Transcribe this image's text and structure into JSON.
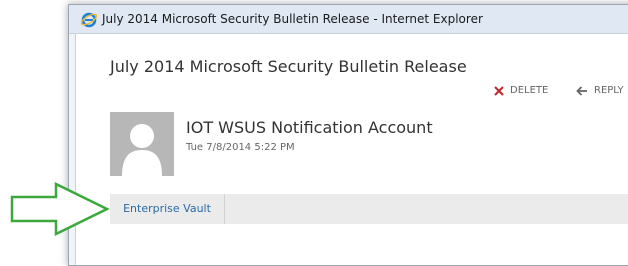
{
  "window": {
    "title": "July 2014 Microsoft Security Bulletin Release - Internet Explorer"
  },
  "message": {
    "subject": "July 2014 Microsoft Security Bulletin Release",
    "sender": "IOT WSUS Notification Account",
    "date": "Tue 7/8/2014 5:22 PM",
    "actions": {
      "delete": "DELETE",
      "reply": "REPLY"
    }
  },
  "tabs": [
    {
      "label": "Enterprise Vault"
    }
  ],
  "colors": {
    "delete_icon": "#c0292b",
    "tab_text": "#2a6aa6",
    "annotation_arrow": "#3aa83a"
  },
  "icons": {
    "browser": "internet-explorer-icon",
    "delete": "x-icon",
    "reply": "reply-arrow-icon",
    "avatar": "person-silhouette-icon"
  }
}
